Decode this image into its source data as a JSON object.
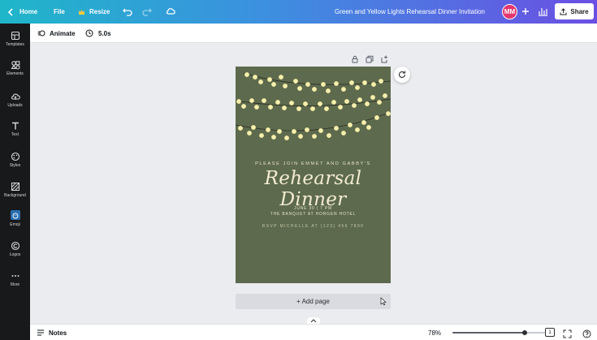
{
  "topbar": {
    "home_label": "Home",
    "file_label": "File",
    "resize_label": "Resize",
    "doc_title": "Green and Yellow Lights Rehearsal Dinner Invitation",
    "avatar_initials": "MM",
    "share_label": "Share",
    "gradient": [
      "#1fb6c9",
      "#3d8fe0",
      "#6b4fe3"
    ],
    "icons": [
      "home-chevron-icon",
      "crown-icon",
      "undo-icon",
      "redo-icon",
      "cloud-save-icon",
      "plus-icon",
      "stats-icon",
      "share-upload-icon"
    ]
  },
  "sidebar": {
    "items": [
      {
        "label": "Templates",
        "icon": "templates-icon"
      },
      {
        "label": "Elements",
        "icon": "elements-icon"
      },
      {
        "label": "Uploads",
        "icon": "uploads-icon"
      },
      {
        "label": "Text",
        "icon": "text-icon"
      },
      {
        "label": "Styles",
        "icon": "styles-icon"
      },
      {
        "label": "Background",
        "icon": "background-icon"
      },
      {
        "label": "Emoji",
        "icon": "emoji-icon"
      },
      {
        "label": "Logos",
        "icon": "logos-icon"
      },
      {
        "label": "More",
        "icon": "more-icon"
      }
    ]
  },
  "toolbar": {
    "animate_label": "Animate",
    "duration_label": "5.0s"
  },
  "canvas": {
    "background_color": "#5d6a4e",
    "invite_line": "PLEASE JOIN EMMET AND GABBY'S",
    "title": "Rehearsal Dinner",
    "date_line": "JUNE 30 | 7 PM",
    "venue_line": "THE BANQUET AT HORGEN HOTEL",
    "rsvp_line": "RSVP MICHELLE AT (123) 456 7890",
    "add_page_label": "+ Add page"
  },
  "bottombar": {
    "notes_label": "Notes",
    "zoom_label": "78%",
    "zoom_fraction": 0.78,
    "page_number": "1"
  }
}
